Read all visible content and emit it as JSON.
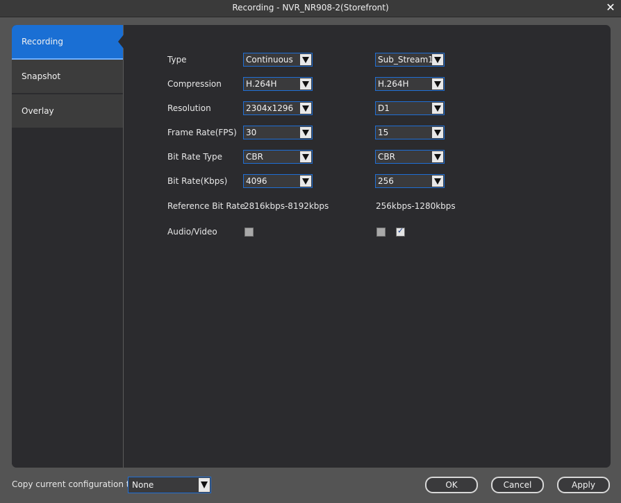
{
  "window": {
    "title": "Recording - NVR_NR908-2(Storefront)"
  },
  "sidebar": {
    "items": [
      {
        "label": "Recording",
        "active": true
      },
      {
        "label": "Snapshot",
        "active": false
      },
      {
        "label": "Overlay",
        "active": false
      }
    ]
  },
  "form": {
    "type": {
      "label": "Type",
      "main": "Continuous",
      "sub": "Sub_Stream1"
    },
    "compression": {
      "label": "Compression",
      "main": "H.264H",
      "sub": "H.264H"
    },
    "resolution": {
      "label": "Resolution",
      "main": "2304x1296",
      "sub": "D1"
    },
    "frame_rate": {
      "label": "Frame Rate(FPS)",
      "main": "30",
      "sub": "15"
    },
    "bit_rate_type": {
      "label": "Bit Rate Type",
      "main": "CBR",
      "sub": "CBR"
    },
    "bit_rate": {
      "label": "Bit Rate(Kbps)",
      "main": "4096",
      "sub": "256"
    },
    "reference_bit_rate": {
      "label": "Reference Bit Rate",
      "main": "2816kbps-8192kbps",
      "sub": "256kbps-1280kbps"
    },
    "audio_video": {
      "label": "Audio/Video",
      "main_checked": false,
      "sub_checked": false,
      "sub_extra_checked": true
    }
  },
  "footer": {
    "copy_label": "Copy current configuration to",
    "copy_value": "None",
    "ok_label": "OK",
    "cancel_label": "Cancel",
    "apply_label": "Apply"
  },
  "colors": {
    "accent": "#1a6fd4",
    "panel": "#2b2b2e",
    "border_blue": "#1f6fd6"
  }
}
